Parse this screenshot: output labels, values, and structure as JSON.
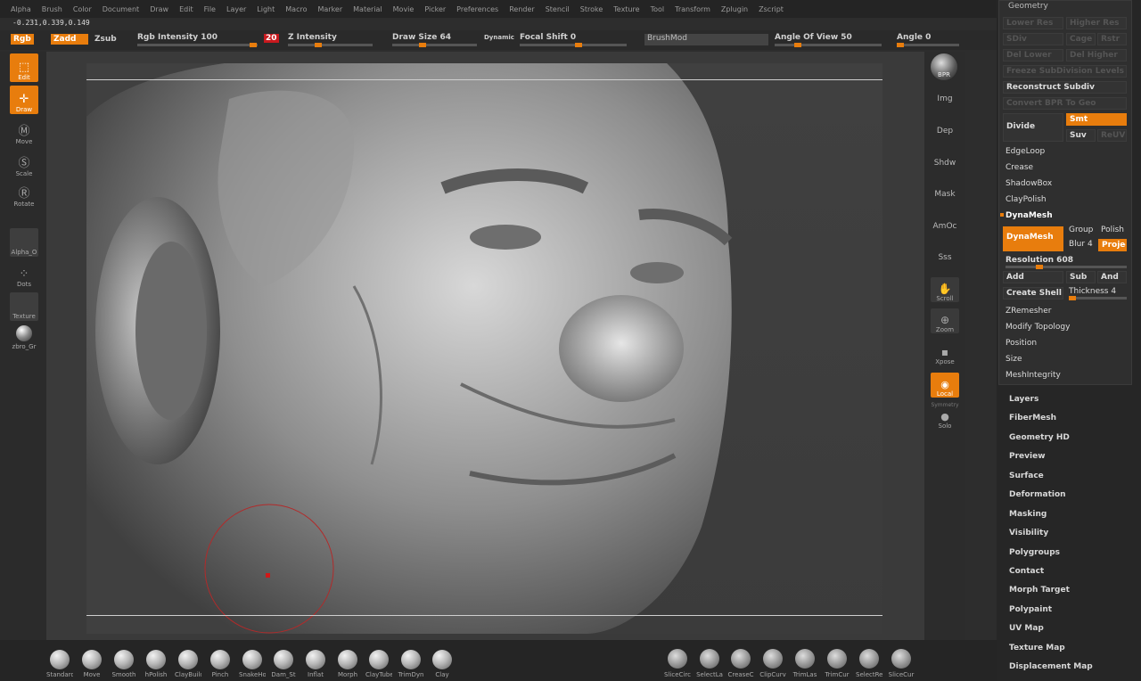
{
  "menu": [
    "Alpha",
    "Brush",
    "Color",
    "Document",
    "Draw",
    "Edit",
    "File",
    "Layer",
    "Light",
    "Macro",
    "Marker",
    "Material",
    "Movie",
    "Picker",
    "Preferences",
    "Render",
    "Stencil",
    "Stroke",
    "Texture",
    "Tool",
    "Transform",
    "Zplugin",
    "Zscript"
  ],
  "coords": "-0.231,0.339,0.149",
  "topbar": {
    "rgb": "Rgb",
    "zadd": "Zadd",
    "zsub": "Zsub",
    "rgb_intensity": "Rgb Intensity 100",
    "z_value": "20",
    "z_intensity": "Z Intensity",
    "draw_size": "Draw Size 64",
    "dynamic": "Dynamic",
    "focal_shift": "Focal Shift 0",
    "brushmod": "BrushMod",
    "angle_of_view": "Angle Of View 50",
    "angle": "Angle 0"
  },
  "left_tools": {
    "edit": "Edit",
    "draw": "Draw",
    "move": "Move",
    "scale": "Scale",
    "rotate": "Rotate",
    "alpha": "Alpha_O",
    "dots": "Dots",
    "texture": "Texture",
    "material": "zbro_Gr"
  },
  "right_shelf": {
    "bpr": "BPR",
    "img": "Img",
    "dep": "Dep",
    "shdw": "Shdw",
    "mask": "Mask",
    "amoc": "AmOc",
    "sss": "Sss",
    "scroll": "Scroll",
    "zoom": "Zoom",
    "xpose": "Xpose",
    "local": "Local",
    "symmetry": "Symmetry",
    "solo": "Solo"
  },
  "geometry": {
    "title": "Geometry",
    "lower_res": "Lower Res",
    "higher_res": "Higher Res",
    "sdiv": "SDiv",
    "cage": "Cage",
    "rstr": "Rstr",
    "del_lower": "Del Lower",
    "del_higher": "Del Higher",
    "freeze": "Freeze SubDivision Levels",
    "reconstruct": "Reconstruct Subdiv",
    "convert_bpr": "Convert BPR To Geo",
    "divide": "Divide",
    "smt": "Smt",
    "suv": "Suv",
    "rsmt": "ReUV",
    "edgeloop": "EdgeLoop",
    "crease": "Crease",
    "shadowbox": "ShadowBox",
    "claypolish": "ClayPolish",
    "dynamesh_section": "DynaMesh",
    "dynamesh_btn": "DynaMesh",
    "group": "Group",
    "polish": "Polish",
    "blur": "Blur 4",
    "project": "Project",
    "resolution": "Resolution 608",
    "add": "Add",
    "sub": "Sub",
    "and": "And",
    "create_shell": "Create Shell",
    "thickness": "Thickness 4",
    "zremesher": "ZRemesher",
    "modify_topology": "Modify Topology",
    "position": "Position",
    "size": "Size",
    "meshintegrity": "MeshIntegrity"
  },
  "subpalettes": [
    "Layers",
    "FiberMesh",
    "Geometry HD",
    "Preview",
    "Surface",
    "Deformation",
    "Masking",
    "Visibility",
    "Polygroups",
    "Contact",
    "Morph Target",
    "Polypaint",
    "UV Map",
    "Texture Map",
    "Displacement Map"
  ],
  "brushes": [
    "Standard",
    "Move",
    "Smooth",
    "hPolish",
    "ClayBuild",
    "Pinch",
    "SnakeHo",
    "Dam_St",
    "Inflat",
    "Morph",
    "ClayTubes",
    "TrimDyn",
    "Clay"
  ],
  "select_tools": [
    "SliceCirc",
    "SelectLa",
    "CreaseC",
    "ClipCurv",
    "TrimLas",
    "TrimCur",
    "SelectRe",
    "SliceCur"
  ]
}
